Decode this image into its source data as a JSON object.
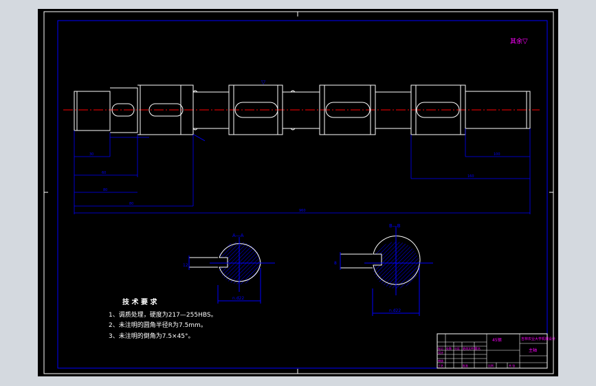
{
  "drawing": {
    "roughness_note": "其余",
    "roughness_mark": "▽",
    "section_aa_label": "A—A",
    "section_bb_label": "B—B",
    "sec_a_dim_width": "12",
    "sec_a_dim_depth": "n.d22",
    "sec_b_dim_width": "8",
    "sec_b_dim_depth": "n.d22",
    "dims": {
      "d1": "30",
      "d2": "60",
      "d3": "80",
      "d4": "80",
      "d5": "360",
      "d6": "100",
      "d7": "160",
      "d8": "960"
    }
  },
  "tech_requirements": {
    "title": "技 术 要 求",
    "items": [
      "1、调质处理，硬度为217—255HBS。",
      "2、未注明的圆角半径R为7.5mm。",
      "3、未注明的倒角为7.5×45°。"
    ]
  },
  "title_block": {
    "material": "45钢",
    "school": "吉林农业大学机械设计",
    "part_name": "主轴",
    "row_labels": [
      "标记",
      "处数",
      "分区",
      "更改文件号",
      "签名",
      "年月日"
    ],
    "design": "设计",
    "check": "审核",
    "process": "工艺",
    "approve": "批准",
    "scale_label": "比例",
    "sheet_label": "共 张"
  },
  "colors": {
    "background": "#000000",
    "frame": "#ffffff",
    "dimension": "#0000ff",
    "centerline": "#ff0000",
    "outline": "#ffffff",
    "hatch": "#0000ff",
    "title_text": "#ff00ff",
    "tech_text": "#ffffff"
  }
}
